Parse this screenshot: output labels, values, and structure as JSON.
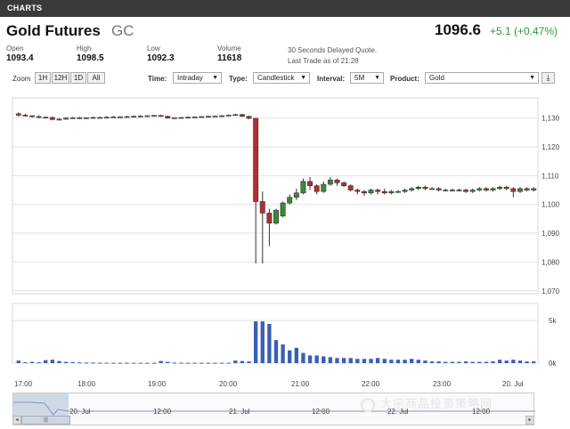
{
  "header": {
    "section": "CHARTS"
  },
  "instrument": {
    "name": "Gold Futures",
    "ticker": "GC",
    "last": "1096.6",
    "change": "+5.1 (+0.47%)"
  },
  "stats": [
    {
      "label": "Open",
      "value": "1093.4"
    },
    {
      "label": "High",
      "value": "1098.5"
    },
    {
      "label": "Low",
      "value": "1092.3"
    },
    {
      "label": "Volume",
      "value": "11618"
    }
  ],
  "delay_note": [
    "30 Seconds Delayed Quote.",
    "Last Trade as of 21:28"
  ],
  "toolbar": {
    "zoom_label": "Zoom",
    "zoom_options": [
      "1H",
      "12H",
      "1D",
      "All"
    ],
    "time_label": "Time:",
    "time_value": "Intraday",
    "type_label": "Type:",
    "type_value": "Candlestick",
    "interval_label": "Interval:",
    "interval_value": "5M",
    "product_label": "Product:",
    "product_value": "Gold"
  },
  "chart_data": {
    "type": "candlestick",
    "price_axis": {
      "ticks": [
        "1,130",
        "1,120",
        "1,110",
        "1,100",
        "1,090",
        "1,080",
        "1,070"
      ],
      "ylim": [
        1070,
        1130
      ]
    },
    "volume_axis": {
      "ticks": [
        "5k",
        "0k"
      ]
    },
    "time_axis": [
      "17:00",
      "18:00",
      "19:00",
      "20:00",
      "21:00",
      "22:00",
      "23:00",
      "20. Jul"
    ],
    "up_color": "#3a8a3a",
    "down_color": "#b03030",
    "volume_color": "#3a5fb5",
    "candles": [
      {
        "o": 1131.5,
        "c": 1131.0,
        "h": 1132,
        "l": 1130.5,
        "v": 300
      },
      {
        "o": 1131.0,
        "c": 1130.8,
        "h": 1131.5,
        "l": 1130.5,
        "v": 100
      },
      {
        "o": 1130.8,
        "c": 1130.5,
        "h": 1131,
        "l": 1130.2,
        "v": 150
      },
      {
        "o": 1130.5,
        "c": 1130.3,
        "h": 1131,
        "l": 1130,
        "v": 100
      },
      {
        "o": 1130.3,
        "c": 1130.2,
        "h": 1130.5,
        "l": 1129.9,
        "v": 350
      },
      {
        "o": 1130.2,
        "c": 1129.5,
        "h": 1130.5,
        "l": 1129.2,
        "v": 400
      },
      {
        "o": 1129.5,
        "c": 1129.6,
        "h": 1130,
        "l": 1129.2,
        "v": 250
      },
      {
        "o": 1129.6,
        "c": 1130.0,
        "h": 1130.3,
        "l": 1129.4,
        "v": 150
      },
      {
        "o": 1130.0,
        "c": 1130.1,
        "h": 1130.4,
        "l": 1129.8,
        "v": 120
      },
      {
        "o": 1130.1,
        "c": 1130.0,
        "h": 1130.4,
        "l": 1129.8,
        "v": 80
      },
      {
        "o": 1130.0,
        "c": 1130.1,
        "h": 1130.3,
        "l": 1129.8,
        "v": 60
      },
      {
        "o": 1130.1,
        "c": 1130.2,
        "h": 1130.5,
        "l": 1129.9,
        "v": 60
      },
      {
        "o": 1130.2,
        "c": 1130.2,
        "h": 1130.5,
        "l": 1130,
        "v": 50
      },
      {
        "o": 1130.2,
        "c": 1130.3,
        "h": 1130.6,
        "l": 1130,
        "v": 50
      },
      {
        "o": 1130.3,
        "c": 1130.4,
        "h": 1130.7,
        "l": 1130.1,
        "v": 40
      },
      {
        "o": 1130.4,
        "c": 1130.4,
        "h": 1130.7,
        "l": 1130.2,
        "v": 40
      },
      {
        "o": 1130.4,
        "c": 1130.5,
        "h": 1130.8,
        "l": 1130.2,
        "v": 40
      },
      {
        "o": 1130.5,
        "c": 1130.6,
        "h": 1130.9,
        "l": 1130.3,
        "v": 40
      },
      {
        "o": 1130.6,
        "c": 1130.7,
        "h": 1131,
        "l": 1130.4,
        "v": 40
      },
      {
        "o": 1130.7,
        "c": 1130.8,
        "h": 1131,
        "l": 1130.5,
        "v": 40
      },
      {
        "o": 1130.8,
        "c": 1130.9,
        "h": 1131.1,
        "l": 1130.6,
        "v": 40
      },
      {
        "o": 1130.9,
        "c": 1130.6,
        "h": 1131.1,
        "l": 1130.4,
        "v": 250
      },
      {
        "o": 1130.6,
        "c": 1130.0,
        "h": 1130.8,
        "l": 1129.8,
        "v": 150
      },
      {
        "o": 1130.0,
        "c": 1130.1,
        "h": 1130.3,
        "l": 1129.9,
        "v": 60
      },
      {
        "o": 1130.1,
        "c": 1130.2,
        "h": 1130.4,
        "l": 1130,
        "v": 50
      },
      {
        "o": 1130.2,
        "c": 1130.3,
        "h": 1130.5,
        "l": 1130.1,
        "v": 40
      },
      {
        "o": 1130.3,
        "c": 1130.4,
        "h": 1130.6,
        "l": 1130.2,
        "v": 40
      },
      {
        "o": 1130.4,
        "c": 1130.5,
        "h": 1130.7,
        "l": 1130.2,
        "v": 40
      },
      {
        "o": 1130.5,
        "c": 1130.6,
        "h": 1130.8,
        "l": 1130.3,
        "v": 40
      },
      {
        "o": 1130.6,
        "c": 1130.7,
        "h": 1130.9,
        "l": 1130.4,
        "v": 40
      },
      {
        "o": 1130.7,
        "c": 1130.8,
        "h": 1131,
        "l": 1130.5,
        "v": 40
      },
      {
        "o": 1130.8,
        "c": 1131.0,
        "h": 1131.2,
        "l": 1130.6,
        "v": 40
      },
      {
        "o": 1131.0,
        "c": 1131.2,
        "h": 1131.5,
        "l": 1130.8,
        "v": 300
      },
      {
        "o": 1131.2,
        "c": 1130.6,
        "h": 1131.5,
        "l": 1130.4,
        "v": 250
      },
      {
        "o": 1130.6,
        "c": 1129.9,
        "h": 1130.8,
        "l": 1129.6,
        "v": 200
      },
      {
        "o": 1129.9,
        "c": 1101.0,
        "h": 1130.0,
        "l": 1079.5,
        "v": 4900
      },
      {
        "o": 1101.0,
        "c": 1097.0,
        "h": 1104.5,
        "l": 1079.5,
        "v": 4900
      },
      {
        "o": 1097.0,
        "c": 1093.5,
        "h": 1098.5,
        "l": 1085.5,
        "v": 4600
      },
      {
        "o": 1093.5,
        "c": 1098.0,
        "h": 1098.5,
        "l": 1093.0,
        "v": 2700
      },
      {
        "o": 1096.0,
        "c": 1100.5,
        "h": 1101.0,
        "l": 1095.5,
        "v": 2200
      },
      {
        "o": 1100.5,
        "c": 1102.5,
        "h": 1103.5,
        "l": 1100.0,
        "v": 1500
      },
      {
        "o": 1102.5,
        "c": 1104.0,
        "h": 1105.5,
        "l": 1101.5,
        "v": 1800
      },
      {
        "o": 1104.0,
        "c": 1108.0,
        "h": 1109.0,
        "l": 1103.5,
        "v": 1200
      },
      {
        "o": 1108.0,
        "c": 1106.5,
        "h": 1109.5,
        "l": 1105.0,
        "v": 900
      },
      {
        "o": 1106.5,
        "c": 1104.5,
        "h": 1107.0,
        "l": 1103.5,
        "v": 900
      },
      {
        "o": 1104.5,
        "c": 1107.0,
        "h": 1108.0,
        "l": 1104.0,
        "v": 800
      },
      {
        "o": 1107.0,
        "c": 1108.5,
        "h": 1109.5,
        "l": 1106.5,
        "v": 700
      },
      {
        "o": 1108.5,
        "c": 1107.5,
        "h": 1109.0,
        "l": 1106.5,
        "v": 600
      },
      {
        "o": 1107.5,
        "c": 1106.5,
        "h": 1108.0,
        "l": 1106.0,
        "v": 600
      },
      {
        "o": 1106.5,
        "c": 1105.0,
        "h": 1107.0,
        "l": 1104.5,
        "v": 600
      },
      {
        "o": 1105.0,
        "c": 1104.5,
        "h": 1105.5,
        "l": 1103.5,
        "v": 500
      },
      {
        "o": 1104.5,
        "c": 1104.0,
        "h": 1105.0,
        "l": 1103.0,
        "v": 500
      },
      {
        "o": 1104.0,
        "c": 1105.0,
        "h": 1105.5,
        "l": 1103.5,
        "v": 500
      },
      {
        "o": 1105.0,
        "c": 1104.5,
        "h": 1105.5,
        "l": 1103.5,
        "v": 600
      },
      {
        "o": 1104.5,
        "c": 1104.0,
        "h": 1105.5,
        "l": 1103.5,
        "v": 500
      },
      {
        "o": 1104.0,
        "c": 1104.5,
        "h": 1105.0,
        "l": 1103.5,
        "v": 400
      },
      {
        "o": 1104.5,
        "c": 1104.5,
        "h": 1105.0,
        "l": 1104.0,
        "v": 400
      },
      {
        "o": 1104.5,
        "c": 1105.0,
        "h": 1105.5,
        "l": 1104.0,
        "v": 400
      },
      {
        "o": 1105.0,
        "c": 1105.5,
        "h": 1106.0,
        "l": 1104.5,
        "v": 500
      },
      {
        "o": 1105.5,
        "c": 1106.0,
        "h": 1106.5,
        "l": 1105.0,
        "v": 400
      },
      {
        "o": 1106.0,
        "c": 1105.5,
        "h": 1106.5,
        "l": 1105.0,
        "v": 300
      },
      {
        "o": 1105.5,
        "c": 1105.5,
        "h": 1106.0,
        "l": 1105.0,
        "v": 200
      },
      {
        "o": 1105.5,
        "c": 1105.0,
        "h": 1106.0,
        "l": 1104.5,
        "v": 200
      },
      {
        "o": 1105.0,
        "c": 1105.0,
        "h": 1105.5,
        "l": 1104.5,
        "v": 150
      },
      {
        "o": 1105.0,
        "c": 1104.8,
        "h": 1105.5,
        "l": 1104.5,
        "v": 150
      },
      {
        "o": 1104.8,
        "c": 1105.0,
        "h": 1105.5,
        "l": 1104.5,
        "v": 150
      },
      {
        "o": 1105.0,
        "c": 1104.5,
        "h": 1105.5,
        "l": 1104.0,
        "v": 200
      },
      {
        "o": 1104.5,
        "c": 1105.0,
        "h": 1105.5,
        "l": 1104.0,
        "v": 150
      },
      {
        "o": 1105.0,
        "c": 1105.5,
        "h": 1106.0,
        "l": 1104.5,
        "v": 150
      },
      {
        "o": 1105.5,
        "c": 1105.0,
        "h": 1106.0,
        "l": 1104.5,
        "v": 150
      },
      {
        "o": 1105.0,
        "c": 1105.5,
        "h": 1106.0,
        "l": 1104.5,
        "v": 200
      },
      {
        "o": 1105.5,
        "c": 1106.0,
        "h": 1106.5,
        "l": 1105.0,
        "v": 400
      },
      {
        "o": 1106.0,
        "c": 1105.5,
        "h": 1106.5,
        "l": 1105.0,
        "v": 300
      },
      {
        "o": 1105.5,
        "c": 1104.5,
        "h": 1106.0,
        "l": 1102.5,
        "v": 400
      },
      {
        "o": 1104.5,
        "c": 1105.5,
        "h": 1106.0,
        "l": 1104.0,
        "v": 300
      },
      {
        "o": 1105.5,
        "c": 1105.0,
        "h": 1106.0,
        "l": 1104.5,
        "v": 200
      },
      {
        "o": 1105.0,
        "c": 1105.5,
        "h": 1106.0,
        "l": 1104.5,
        "v": 200
      }
    ]
  },
  "navigator": {
    "labels": [
      "20. Jul",
      "12:00",
      "21. Jul",
      "12:00",
      "22. Jul",
      "12:00"
    ],
    "scroll_left": "◂",
    "scroll_right": "▸",
    "scroll_thumb": "|||"
  },
  "watermark": "大宗商品投资策略网"
}
